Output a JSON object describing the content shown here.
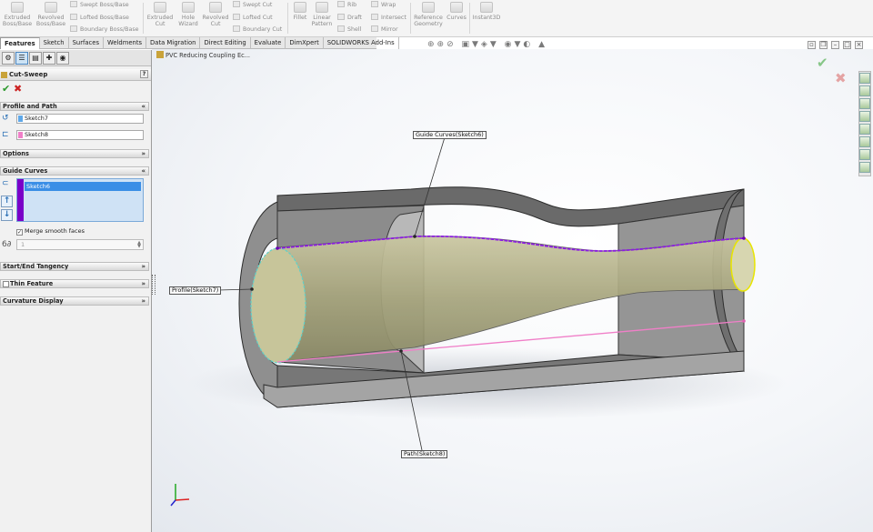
{
  "ribbon": {
    "extruded_boss": "Extruded Boss/Base",
    "revolved_boss": "Revolved Boss/Base",
    "swept_boss": "Swept Boss/Base",
    "lofted_boss": "Lofted Boss/Base",
    "boundary_boss": "Boundary Boss/Base",
    "extruded_cut": "Extruded Cut",
    "hole_wizard": "Hole Wizard",
    "revolved_cut": "Revolved Cut",
    "swept_cut": "Swept Cut",
    "lofted_cut": "Lofted Cut",
    "boundary_cut": "Boundary Cut",
    "fillet": "Fillet",
    "linear_pattern": "Linear Pattern",
    "rib": "Rib",
    "draft": "Draft",
    "shell": "Shell",
    "wrap": "Wrap",
    "intersect": "Intersect",
    "mirror": "Mirror",
    "reference_geometry": "Reference Geometry",
    "curves": "Curves",
    "instant3d": "Instant3D"
  },
  "tabs": [
    {
      "label": "Features",
      "active": true
    },
    {
      "label": "Sketch"
    },
    {
      "label": "Surfaces"
    },
    {
      "label": "Weldments"
    },
    {
      "label": "Data Migration"
    },
    {
      "label": "Direct Editing"
    },
    {
      "label": "Evaluate"
    },
    {
      "label": "DimXpert"
    },
    {
      "label": "SOLIDWORKS Add-Ins"
    }
  ],
  "panel": {
    "title": "Cut-Sweep",
    "help": "?",
    "ok": "✔",
    "cancel": "✖",
    "profile_and_path": "Profile and Path",
    "profile_value": "Sketch7",
    "path_value": "Sketch8",
    "options": "Options",
    "guide_curves": "Guide Curves",
    "guide_item": "Sketch6",
    "merge_smooth": "Merge smooth faces",
    "merge_checked": true,
    "spin_value": "1",
    "start_end": "Start/End Tangency",
    "thin_feature": "Thin Feature",
    "curvature_display": "Curvature Display",
    "profile_color": "#5fa8e8",
    "path_color": "#f07fc8",
    "guide_color": "#7a00c8"
  },
  "viewport": {
    "tree_label": "PVC Reducing Coupling Ec...",
    "callout_guide": "Guide Curves(Sketch6)",
    "callout_profile": "Profile(Sketch7)",
    "callout_path": "Path(Sketch8)"
  }
}
